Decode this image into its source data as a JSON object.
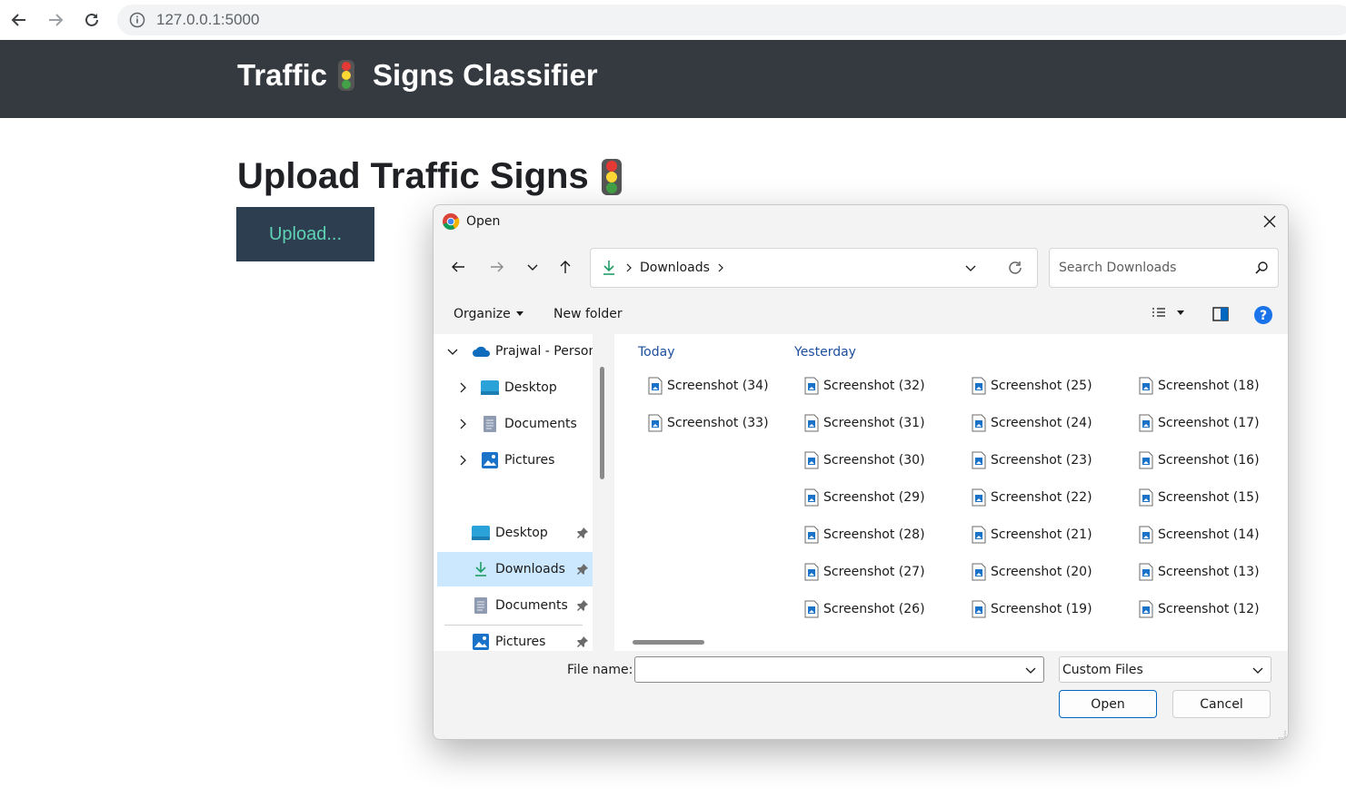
{
  "browser": {
    "address": "127.0.0.1:5000",
    "icons": [
      "back-arrow-icon",
      "forward-arrow-icon",
      "reload-icon",
      "info-icon"
    ]
  },
  "app": {
    "brand_left": "Traffic",
    "brand_right": "Signs Classifier",
    "heading": "Upload Traffic Signs",
    "upload_label": "Upload...",
    "colors": {
      "navbar": "#343a40",
      "upload_bg": "#2c3e50",
      "upload_text": "#5fd3b5"
    }
  },
  "dialog": {
    "title": "Open",
    "path_segment": "Downloads",
    "search_placeholder": "Search Downloads",
    "organize_label": "Organize",
    "new_folder_label": "New folder",
    "sidebar": {
      "root": "Prajwal - Person",
      "tree": [
        "Desktop",
        "Documents",
        "Pictures"
      ],
      "quick_access": [
        {
          "label": "Desktop",
          "selected": false
        },
        {
          "label": "Downloads",
          "selected": true
        },
        {
          "label": "Documents",
          "selected": false
        },
        {
          "label": "Pictures",
          "selected": false
        }
      ]
    },
    "groups": {
      "today": "Today",
      "yesterday": "Yesterday"
    },
    "files": {
      "today": [
        "Screenshot (34)",
        "Screenshot (33)"
      ],
      "yesterday_col1": [
        "Screenshot (32)",
        "Screenshot (31)",
        "Screenshot (30)",
        "Screenshot (29)",
        "Screenshot (28)",
        "Screenshot (27)",
        "Screenshot (26)"
      ],
      "yesterday_col2": [
        "Screenshot (25)",
        "Screenshot (24)",
        "Screenshot (23)",
        "Screenshot (22)",
        "Screenshot (21)",
        "Screenshot (20)",
        "Screenshot (19)"
      ],
      "yesterday_col3": [
        "Screenshot (18)",
        "Screenshot (17)",
        "Screenshot (16)",
        "Screenshot (15)",
        "Screenshot (14)",
        "Screenshot (13)",
        "Screenshot (12)"
      ]
    },
    "footer": {
      "file_name_label": "File name:",
      "file_name_value": "",
      "file_type": "Custom Files",
      "open_label": "Open",
      "cancel_label": "Cancel"
    },
    "accent": "#0067c0"
  }
}
